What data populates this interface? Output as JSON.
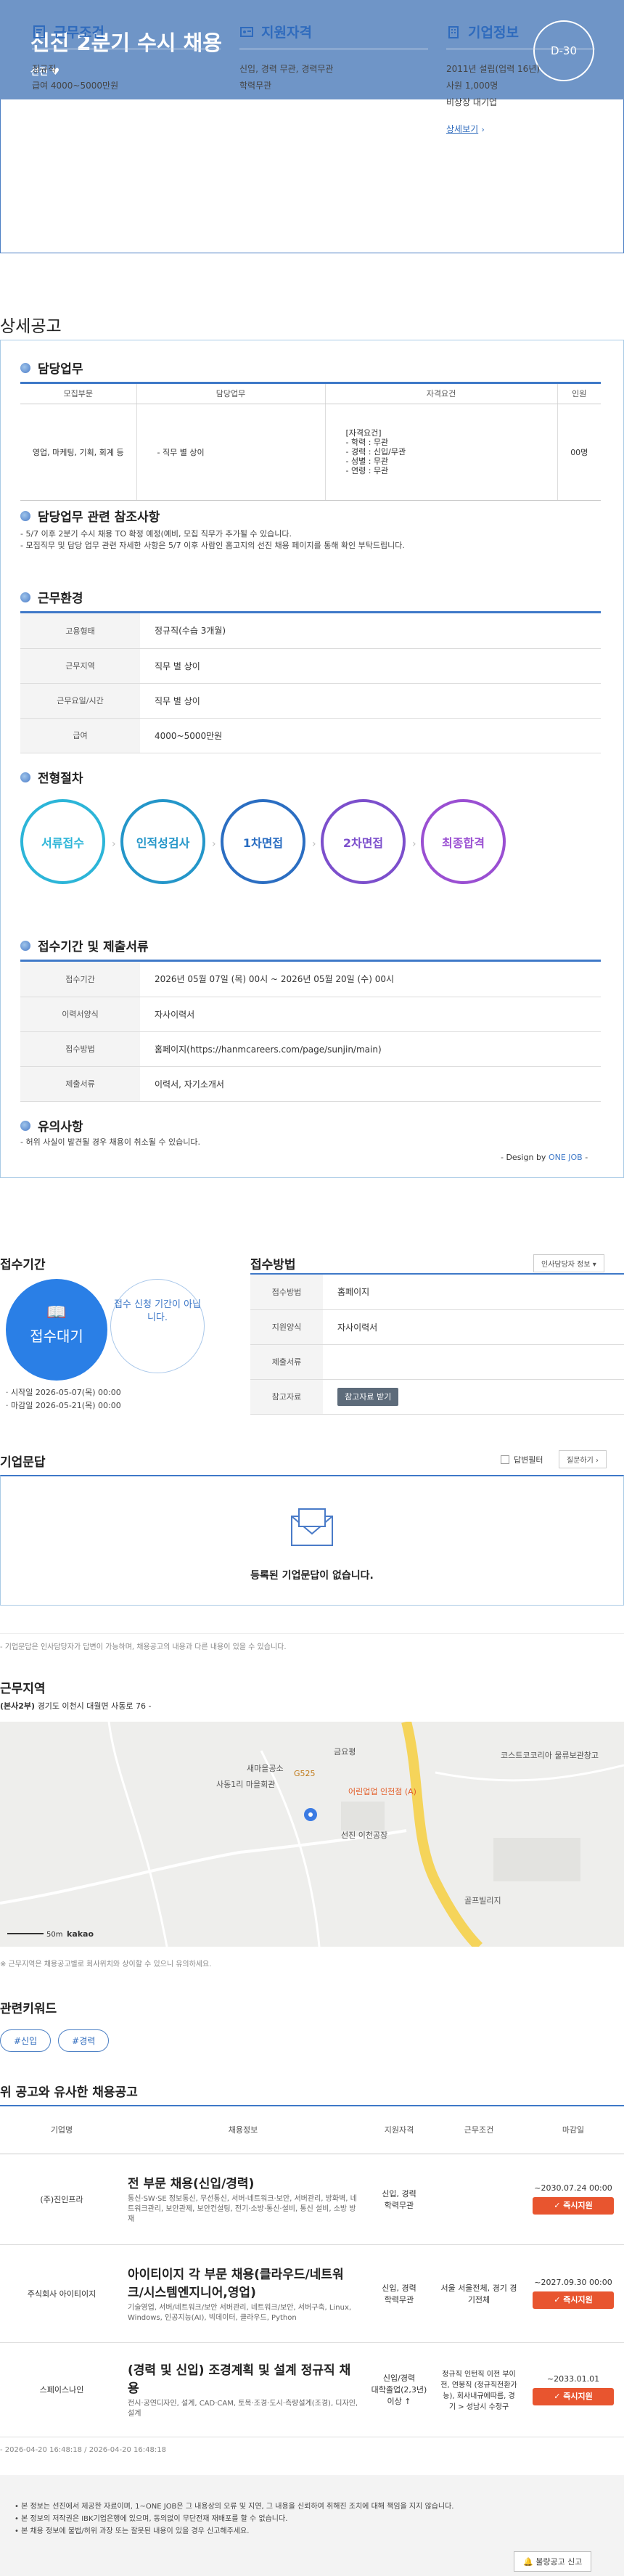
{
  "hero": {
    "title": "선진 2분기 수시 채용",
    "company": "선진",
    "dday": "D-30"
  },
  "summary": {
    "cond": {
      "title": "근무조건",
      "lines": [
        "정규직",
        "급여 4000~5000만원"
      ]
    },
    "qual": {
      "title": "지원자격",
      "lines": [
        "신입, 경력 무관, 경력무관",
        "학력무관"
      ]
    },
    "info": {
      "title": "기업정보",
      "lines": [
        "2011년 설립(업력 16년)",
        "사원 1,000명",
        "비상장 대기업"
      ],
      "link": "상세보기"
    }
  },
  "detail_heading": "상세공고",
  "duty": {
    "title": "담당업무",
    "headers": [
      "모집부문",
      "담당업무",
      "자격요건",
      "인원"
    ],
    "row": [
      "영업, 마케팅, 기획, 회계 등",
      "- 직무 별 상이",
      "[자격요건]\n- 학력 : 무관\n- 경력 : 신입/무관\n- 성별 : 무관\n- 연령 : 무관",
      "00명"
    ]
  },
  "ref": {
    "title": "담당업무 관련 참조사항",
    "lines": [
      "- 5/7 이후 2분기 수시 채용 TO 확정 예정(예비, 모집 직무가 추가될 수 있습니다.",
      "- 모집직무 및 담당 업무 관련 자세한 사항은 5/7 이후 사람인 홈고지의 선진 채용 페이지를 통해 확인 부탁드립니다."
    ]
  },
  "env": {
    "title": "근무환경",
    "rows": [
      [
        "고용형태",
        "정규직(수습 3개월)"
      ],
      [
        "근무지역",
        "직무 별 상이"
      ],
      [
        "근무요일/시간",
        "직무 별 상이"
      ],
      [
        "급여",
        "4000~5000만원"
      ]
    ]
  },
  "process": {
    "title": "전형절차",
    "steps": [
      "서류접수",
      "인적성검사",
      "1차면접",
      "2차면접",
      "최종합격"
    ],
    "colors": [
      "#2cb5d8",
      "#2496c9",
      "#2b6ec2",
      "#7c4fcc",
      "#9a4fd2"
    ]
  },
  "reception": {
    "title": "접수기간 및 제출서류",
    "rows": [
      [
        "접수기간",
        "2026년 05월 07일 (목) 00시 ~ 2026년 05월 20일 (수) 00시"
      ],
      [
        "이력서양식",
        "자사이력서"
      ],
      [
        "접수방법",
        "홈페이지(https://hanmcareers.com/page/sunjin/main)"
      ],
      [
        "제출서류",
        "이력서, 자기소개서"
      ]
    ]
  },
  "caution": {
    "title": "유의사항",
    "lines": [
      "- 허위 사실이 발견될 경우 채용이 취소될 수 있습니다."
    ],
    "design": "- Design by ",
    "design_brand": "ONE JOB",
    "design_end": " -"
  },
  "period": {
    "title": "접수기간",
    "status": "접수대기",
    "status2": "접수 신청 기간이 아닙니다.",
    "start_label": "시작일",
    "start": "2026-05-07(목) 00:00",
    "end_label": "마감일",
    "end": "2026-05-21(목) 00:00"
  },
  "method": {
    "title": "접수방법",
    "contact_btn": "인사담당자 정보",
    "rows": [
      [
        "접수방법",
        "홈페이지"
      ],
      [
        "지원양식",
        "자사이력서"
      ],
      [
        "제출서류",
        ""
      ],
      [
        "참고자료",
        ""
      ]
    ],
    "attach_btn": "참고자료 받기"
  },
  "qa": {
    "title": "기업문답",
    "answered": "답변필터",
    "ask_btn": "질문하기",
    "empty": "등록된 기업문답이 없습니다.",
    "note": "- 기업문답은 인사담당자가 답변이 가능하며, 채용공고의 내용과 다른 내용이 있을 수 있습니다."
  },
  "location": {
    "title": "근무지역",
    "addr_label": "(본사2부)",
    "addr": "경기도 이천시 대월면 사동로 76 -",
    "note": "※ 근무지역은 채용공고별로 회사위치와 상이할 수 있으니 유의하세요.",
    "map_labels": [
      "사동1리 마을회관",
      "새마을공소",
      "선진 이천공장",
      "코스트코코리아 물류보관창고",
      "어린업업 인천점 (A)",
      "골프빌리지",
      "금요평",
      "G525"
    ],
    "scale": "50m",
    "kakao": "kakao"
  },
  "keywords": {
    "title": "관련키워드",
    "items": [
      "#신입",
      "#경력"
    ]
  },
  "similar": {
    "title": "위 공고와 유사한 채용공고",
    "headers": [
      "기업명",
      "채용정보",
      "지원자격",
      "근무조건",
      "마감일"
    ],
    "rows": [
      {
        "company": "(주)진인프라",
        "title": "전 부문 채용(신입/경력)",
        "desc": "통신·SW·SE 정보통신, 무선통신, 서버·네트워크·보안, 서버관리, 방화벽, 네트워크관리, 보안관제, 보안컨설팅, 전기·소방·통신·설비, 통신 설비, 소방 방재",
        "qual": "신입, 경력\n학력무관",
        "cond": "",
        "deadline": "~2030.07.24 00:00",
        "btn": "즉시지원"
      },
      {
        "company": "주식회사 아이티이지",
        "title": "아이티이지 각 부문 채용(클라우드/네트워크/시스템엔지니어,영업)",
        "desc": "기술영업, 서버/네트워크/보안 서버관리, 네트워크/보안, 서버구축, Linux, Windows, 인공지능(AI), 빅데이터, 클라우드, Python",
        "qual": "신입, 경력\n학력무관",
        "cond": "서울 서울전체, 경기 경기전체",
        "deadline": "~2027.09.30 00:00",
        "btn": "즉시지원"
      },
      {
        "company": "스페이스나인",
        "title": "(경력 및 신입) 조경계획 및 설계 정규직 채용",
        "desc": "전시·공연디자인, 설계, CAD·CAM, 토목·조경·도시·측량설계(조경), 디자인, 설계",
        "qual": "신입/경력\n대학졸업(2,3년)\n이상 ↑",
        "cond": "정규직 인턴직 이전 부이전, 연봉직 (정규직전환가능), 회사내규에따름, 경기 > 성남시 수정구",
        "deadline": "~2033.01.01",
        "btn": "즉시지원"
      }
    ]
  },
  "footer": {
    "dates": "- 2026-04-20 16:48:18 / 2026-04-20 16:48:18",
    "notes": [
      "본 정보는 선진에서 제공한 자료이며, 1~ONE JOB은 그 내용상의 오류 및 지연, 그 내용을 신뢰하여 취해진 조치에 대해 책임을 지지 않습니다.",
      "본 정보의 저작권은 IBK기업은행에 있으며, 동의없이 무단전재 재배포를 할 수 없습니다.",
      "본 채용 정보에 불법/허위 과장 또는 잘못된 내용이 있을 경우 신고해주세요."
    ],
    "report_btn": "불량공고 신고"
  }
}
